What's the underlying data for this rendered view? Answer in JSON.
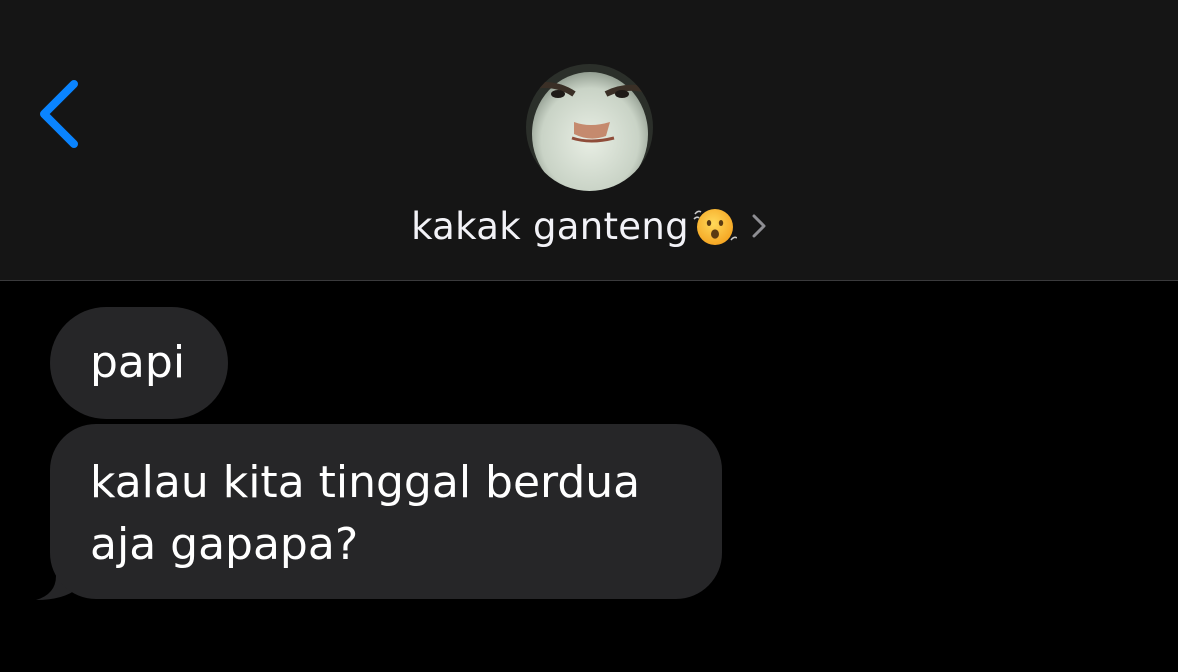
{
  "header": {
    "contact_name": "kakak ganteng",
    "contact_emoji": "face-with-open-mouth-emoji"
  },
  "messages": [
    {
      "direction": "incoming",
      "text": "papi"
    },
    {
      "direction": "incoming",
      "text": "kalau kita tinggal berdua aja gapapa?"
    }
  ],
  "colors": {
    "accent": "#0a84ff",
    "header_bg": "#151515",
    "background": "#000000",
    "bubble_incoming": "#262628",
    "text": "#ffffff"
  }
}
